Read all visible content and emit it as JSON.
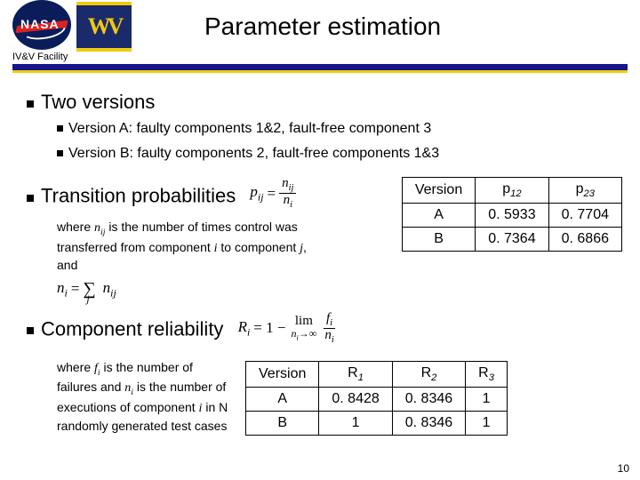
{
  "header": {
    "title": "Parameter estimation",
    "facility_label": "IV&V Facility",
    "nasa_text": "NASA",
    "wv_text": "WV"
  },
  "page_number": "10",
  "sections": {
    "two_versions": {
      "heading": "Two versions",
      "bullet_a": "Version A: faulty components 1&2, fault-free component 3",
      "bullet_b": "Version B: faulty components 2, fault-free components 1&3"
    },
    "transition": {
      "heading": "Transition probabilities",
      "where_prefix": "where ",
      "where_mid": " is the number of times control was transferred from component ",
      "where_i": "i",
      "where_to": " to component ",
      "where_j": "j",
      "where_suffix": ", and",
      "n_ij": "n",
      "formula_lhs": "p",
      "formula_eq": "=",
      "formula_num": "n",
      "formula_den": "n",
      "sum_lhs": "n",
      "sum_eq": "=",
      "sum_sig": "∑",
      "sum_sub": "j",
      "sum_rhs": "n"
    },
    "reliability": {
      "heading": "Component reliability",
      "where_prefix": "where ",
      "f_i": "f",
      "where_mid1": " is the number of failures and ",
      "n_i": "n",
      "where_mid2": " is the number of executions of component ",
      "i": "i",
      "where_mid3": " in N randomly generated test cases",
      "formula_R": "R",
      "formula_eq": "= 1 −",
      "formula_lim": "lim",
      "formula_lim_sub": "n→∞",
      "formula_num": "f",
      "formula_den": "n"
    }
  },
  "table1": {
    "headers": {
      "c0": "Version",
      "c1_base": "p",
      "c1_sub": "12",
      "c2_base": "p",
      "c2_sub": "23"
    },
    "rows": [
      {
        "version": "A",
        "p12": "0. 5933",
        "p23": "0. 7704"
      },
      {
        "version": "B",
        "p12": "0. 7364",
        "p23": "0. 6866"
      }
    ]
  },
  "table2": {
    "headers": {
      "c0": "Version",
      "c1_base": "R",
      "c1_sub": "1",
      "c2_base": "R",
      "c2_sub": "2",
      "c3_base": "R",
      "c3_sub": "3"
    },
    "rows": [
      {
        "version": "A",
        "r1": "0. 8428",
        "r2": "0. 8346",
        "r3": "1"
      },
      {
        "version": "B",
        "r1": "1",
        "r2": "0. 8346",
        "r3": "1"
      }
    ]
  }
}
